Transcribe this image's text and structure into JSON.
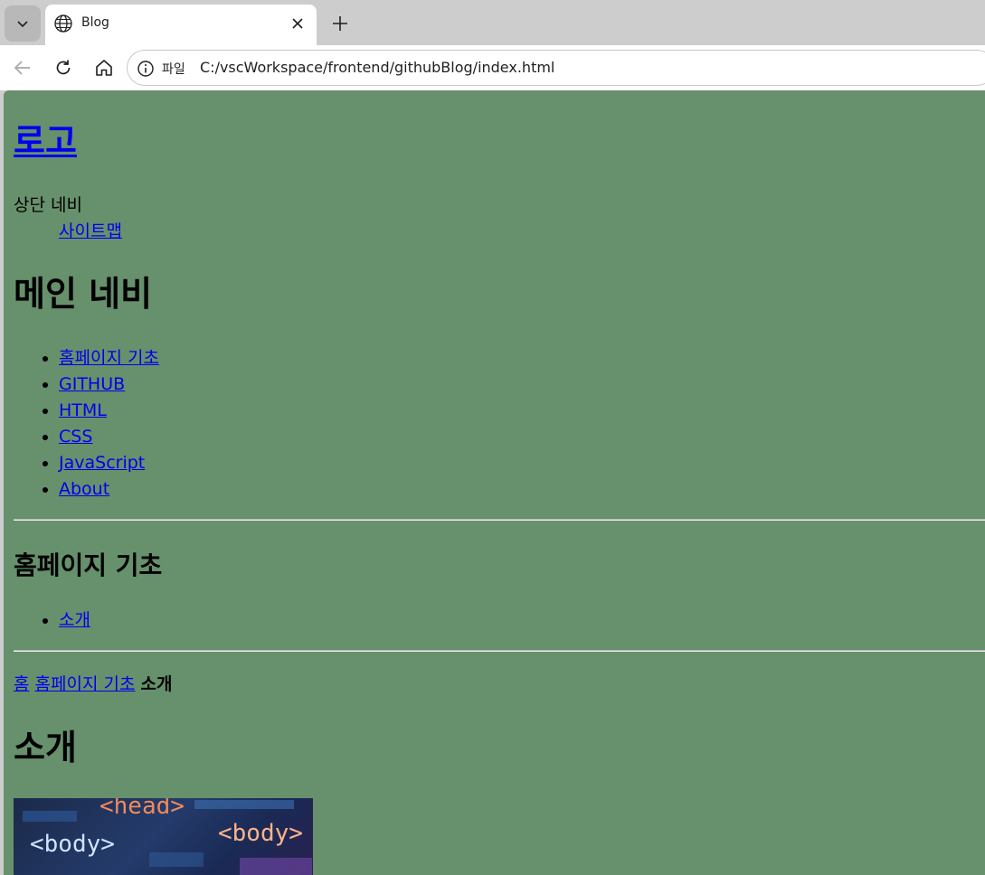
{
  "browser": {
    "tab": {
      "title": "Blog"
    },
    "address_bar": {
      "scheme_label": "파일",
      "url": "C:/vscWorkspace/frontend/githubBlog/index.html"
    }
  },
  "page": {
    "background_color": "#67906c",
    "logo": "로고",
    "top_nav": {
      "label": "상단 네비",
      "link": "사이트맵"
    },
    "main_nav": {
      "heading": "메인 네비",
      "items": [
        "홈페이지 기초",
        "GITHUB",
        "HTML",
        "CSS",
        "JavaScript",
        "About"
      ]
    },
    "section": {
      "heading": "홈페이지 기초",
      "items": [
        "소개"
      ]
    },
    "breadcrumb": {
      "home": "홈",
      "category": "홈페이지 기초",
      "current": "소개"
    },
    "title": "소개",
    "hero_image": {
      "tags": [
        "<head>",
        "<body>",
        "<body>"
      ]
    }
  }
}
